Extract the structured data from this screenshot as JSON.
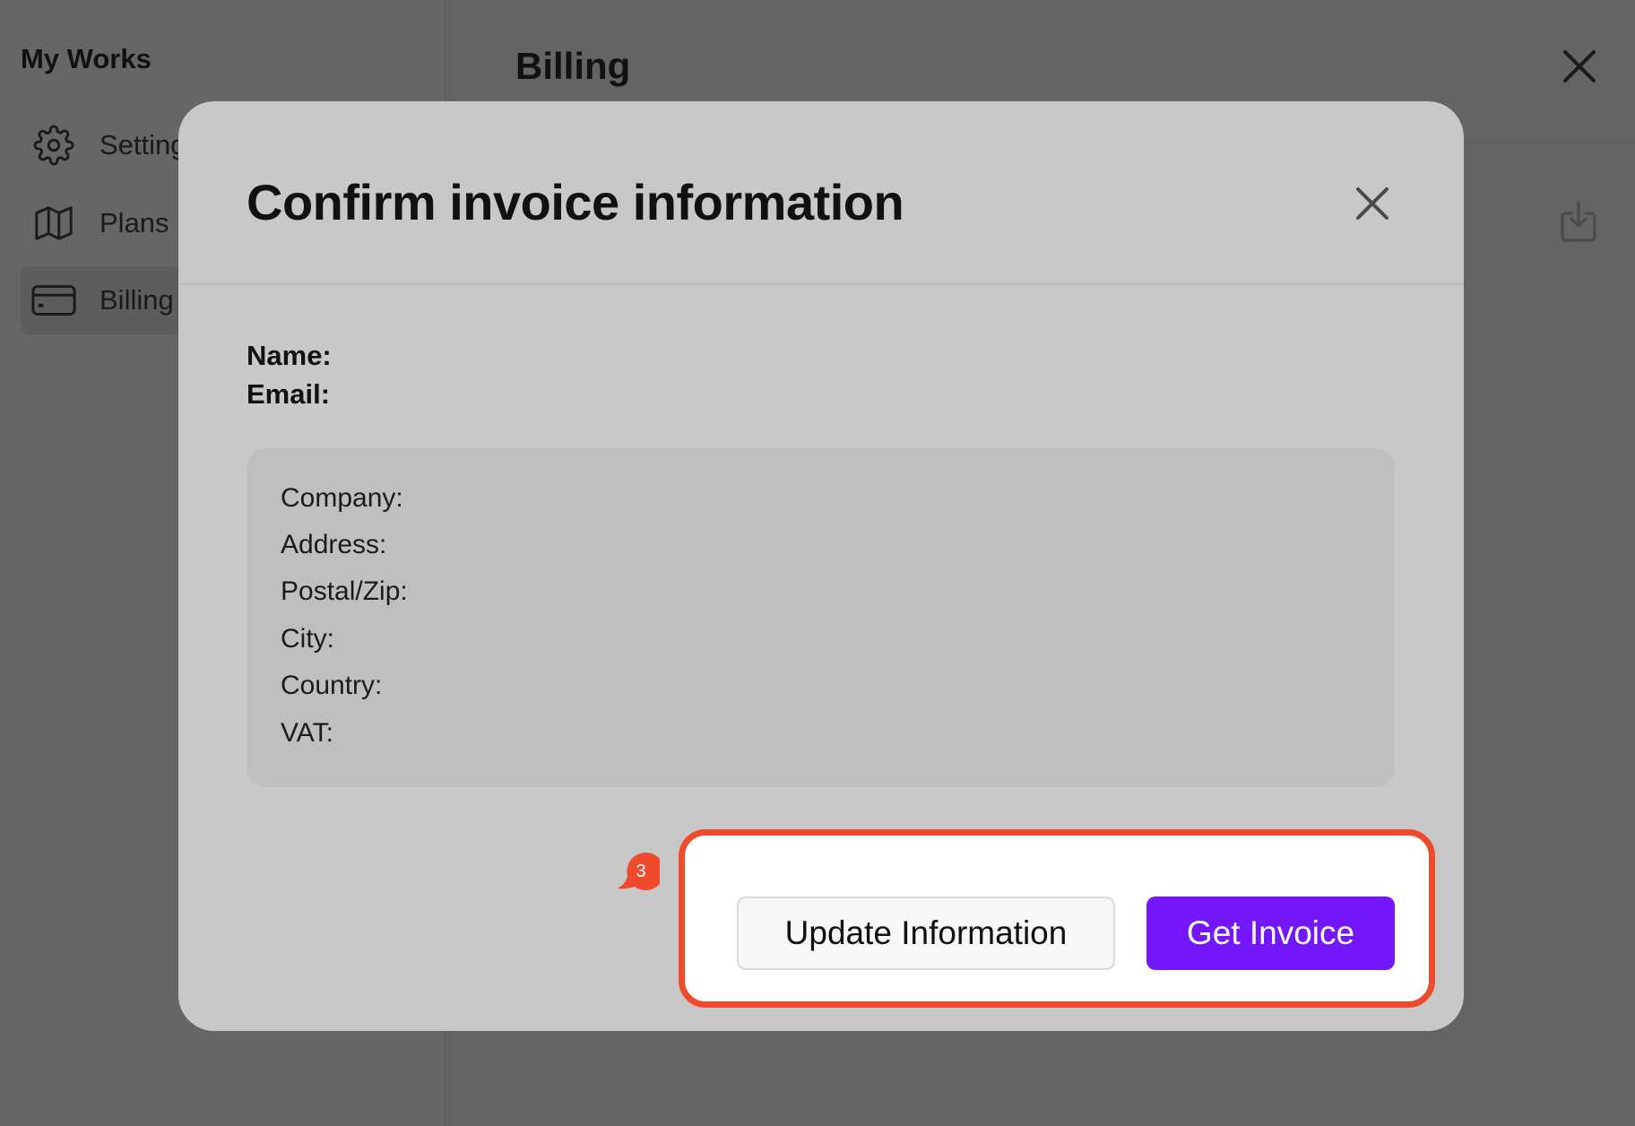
{
  "sidebar": {
    "brand": "My Works",
    "items": [
      {
        "label": "Settings",
        "icon": "gear-icon"
      },
      {
        "label": "Plans",
        "icon": "map-icon"
      },
      {
        "label": "Billing",
        "icon": "credit-card-icon",
        "active": true
      }
    ]
  },
  "header": {
    "title": "Billing"
  },
  "modal": {
    "title": "Confirm invoice information",
    "name_label": "Name:",
    "name_value": "",
    "email_label": "Email:",
    "email_value": "",
    "fields": [
      {
        "label": "Company:"
      },
      {
        "label": "Address:"
      },
      {
        "label": "Postal/Zip:"
      },
      {
        "label": "City:"
      },
      {
        "label": "Country:"
      },
      {
        "label": "VAT:"
      }
    ],
    "update_button": "Update Information",
    "get_invoice_button": "Get Invoice"
  },
  "annotation": {
    "step": "3",
    "color": "#f04a2c"
  },
  "colors": {
    "primary": "#7417fa",
    "overlay": "#646464",
    "modal_bg": "#c8c8c8"
  }
}
